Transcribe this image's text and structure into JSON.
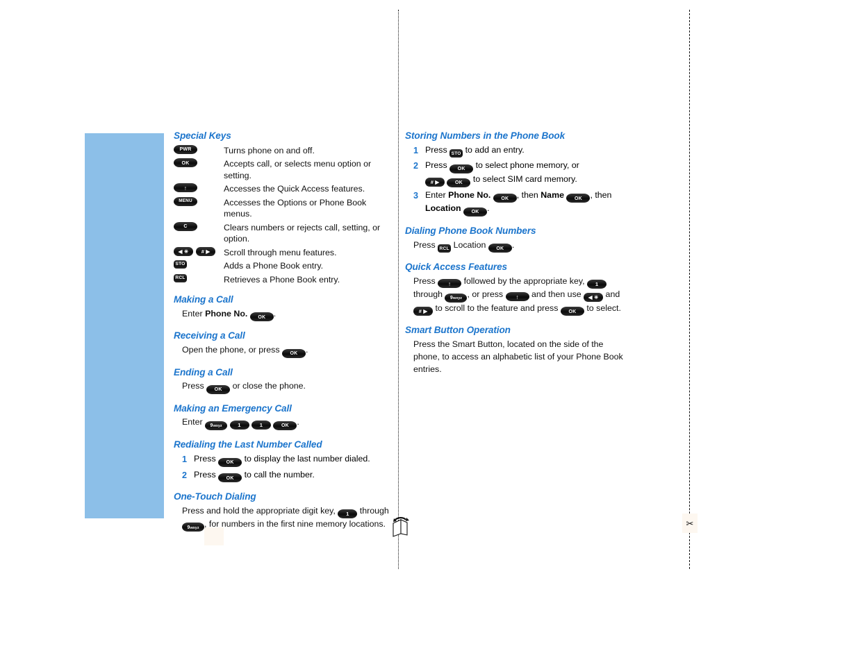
{
  "page": {
    "background_color": "#ffffff",
    "panel_color": "#8CBFE8",
    "heading_color": "#1C75CC",
    "key_color": "#111111"
  },
  "markers": {
    "fold_icon_name": "fold-here-icon",
    "scissors_icon_name": "cut-here-scissors-icon",
    "scissors_glyph": "✂"
  },
  "keys": {
    "pwr": "PWR",
    "ok": "OK",
    "menu": "MENU",
    "clear": "C",
    "sto": "STO",
    "rcl": "RCL",
    "up": "↑",
    "star": "◀ ✳",
    "hash": "# ▶",
    "one": "1",
    "nine": "9",
    "nine_sub": "wxyz"
  },
  "left_column": {
    "special_keys": {
      "title": "Special Keys",
      "rows": [
        {
          "keys": [
            "pwr"
          ],
          "description": "Turns phone on and off."
        },
        {
          "keys": [
            "ok"
          ],
          "description": "Accepts call, or selects menu option or setting."
        },
        {
          "keys": [
            "up"
          ],
          "description": "Accesses the Quick Access features."
        },
        {
          "keys": [
            "menu"
          ],
          "description": "Accesses the Options or Phone Book menus."
        },
        {
          "keys": [
            "clear"
          ],
          "description": "Clears numbers or rejects call, setting, or option."
        },
        {
          "keys": [
            "star",
            "hash"
          ],
          "description": "Scroll through menu features."
        },
        {
          "keys": [
            "sto"
          ],
          "description": "Adds a Phone Book entry."
        },
        {
          "keys": [
            "rcl"
          ],
          "description": "Retrieves a Phone Book entry."
        }
      ]
    },
    "making_a_call": {
      "title": "Making a Call",
      "text_1": "Enter ",
      "bold_1": "Phone No.",
      "text_2": "."
    },
    "receiving_a_call": {
      "title": "Receiving a Call",
      "text_1": "Open the phone, or press ",
      "text_2": "."
    },
    "ending_a_call": {
      "title": "Ending a Call",
      "text_1": "Press ",
      "text_2": " or close the phone."
    },
    "emergency_call": {
      "title": "Making an Emergency Call",
      "text_1": "Enter ",
      "text_2": "."
    },
    "redialing": {
      "title": "Redialing the Last Number Called",
      "steps": [
        {
          "num": "1",
          "text_1": "Press ",
          "text_2": " to display the last number dialed."
        },
        {
          "num": "2",
          "text_1": "Press ",
          "text_2": " to call the number."
        }
      ]
    },
    "one_touch": {
      "title": "One-Touch Dialing",
      "text_1": "Press and hold the appropriate digit key, ",
      "text_2": " through ",
      "text_3": ", for numbers in the first nine memory locations."
    }
  },
  "right_column": {
    "storing_numbers": {
      "title": "Storing Numbers in the Phone Book",
      "step1": {
        "num": "1",
        "text_1": "Press ",
        "text_2": " to add an entry."
      },
      "step2": {
        "num": "2",
        "text_1": "Press ",
        "text_2": " to select phone memory, or",
        "text_3": " to select SIM card memory."
      },
      "step3": {
        "num": "3",
        "text_1": "Enter ",
        "bold_1": "Phone No.",
        "text_2": ", then ",
        "bold_2": "Name",
        "text_3": ", then ",
        "bold_3": "Location",
        "text_4": "."
      }
    },
    "dialing_phone_book": {
      "title": "Dialing Phone Book Numbers",
      "text_1": "Press ",
      "text_2": " Location ",
      "text_3": "."
    },
    "quick_access": {
      "title": "Quick Access Features",
      "text_1": "Press ",
      "text_2": " followed by the appropriate key, ",
      "text_3": " through ",
      "text_4": ", or press ",
      "text_5": " and then use ",
      "text_6": " and ",
      "text_7": " to scroll to the feature and press ",
      "text_8": " to select."
    },
    "smart_button": {
      "title": "Smart Button Operation",
      "text_1": "Press the Smart Button, located on the side of the phone, to access an alphabetic list of your Phone Book entries."
    }
  }
}
